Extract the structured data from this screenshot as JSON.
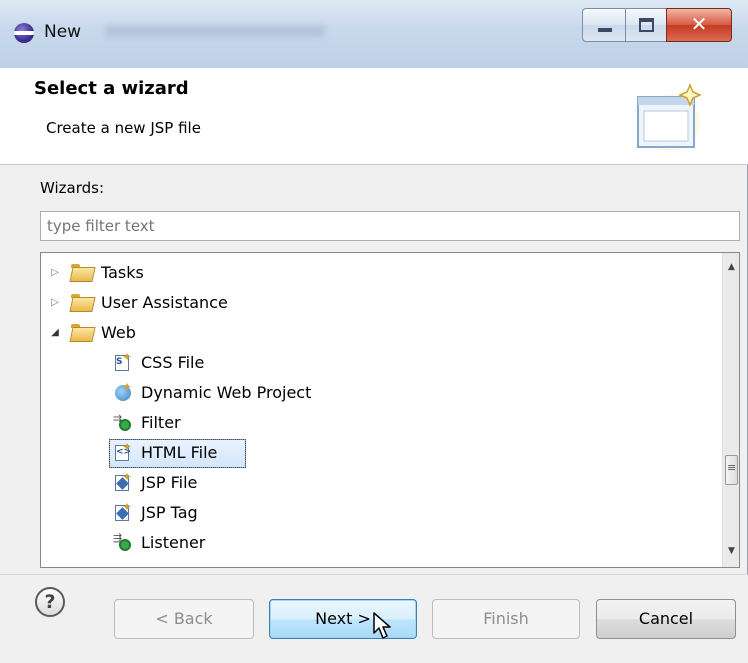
{
  "window": {
    "title": "New"
  },
  "banner": {
    "heading": "Select a wizard",
    "description": "Create a new JSP file"
  },
  "wizards_label": "Wizards:",
  "filter": {
    "placeholder": "type filter text"
  },
  "tree": {
    "items": [
      {
        "label": "Tasks",
        "kind": "folder",
        "expanded": false
      },
      {
        "label": "User Assistance",
        "kind": "folder",
        "expanded": false
      },
      {
        "label": "Web",
        "kind": "folder",
        "expanded": true
      },
      {
        "label": "CSS File",
        "icon": "css-file-icon"
      },
      {
        "label": "Dynamic Web Project",
        "icon": "dynamic-web-project-icon"
      },
      {
        "label": "Filter",
        "icon": "filter-icon"
      },
      {
        "label": "HTML File",
        "icon": "html-file-icon"
      },
      {
        "label": "JSP File",
        "icon": "jsp-file-icon",
        "selected": true
      },
      {
        "label": "JSP Tag",
        "icon": "jsp-tag-icon"
      },
      {
        "label": "Listener",
        "icon": "listener-icon"
      }
    ]
  },
  "buttons": {
    "help": "?",
    "back": "< Back",
    "next": "Next >",
    "finish": "Finish",
    "cancel": "Cancel"
  },
  "colors": {
    "selection": "#d3e6fb",
    "next_button": "#bee6fd",
    "close_button": "#c43b22"
  }
}
